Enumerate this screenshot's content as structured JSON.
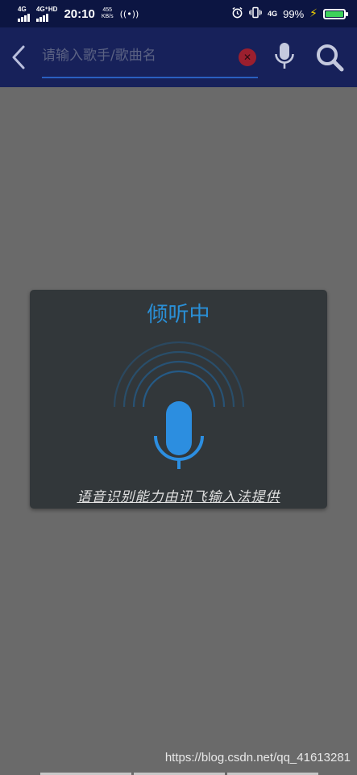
{
  "status_bar": {
    "sim1_label": "4G",
    "sim2_label": "4G⁺HD",
    "time": "20:10",
    "speed_value": "455",
    "speed_unit": "KB/s",
    "network_label": "4G",
    "battery_percent": "99%",
    "battery_level": 0.99,
    "battery_color": "#3ed35a",
    "icons": [
      "signal-icon",
      "hotspot-icon",
      "alarm-icon",
      "vibrate-icon",
      "charging-icon",
      "battery-icon"
    ]
  },
  "search_bar": {
    "placeholder": "请输入歌手/歌曲名",
    "value": "",
    "back_icon": "chevron-left-icon",
    "clear_icon": "clear-icon",
    "mic_icon": "microphone-icon",
    "search_icon": "search-icon",
    "background_color": "#17215a",
    "accent_color": "#2a5fc0"
  },
  "dialog": {
    "title": "倾听中",
    "caption": "语音识别能力由讯飞输入法提供",
    "mic_icon": "microphone-icon",
    "accent_color": "#2a8fd6"
  },
  "watermark": "https://blog.csdn.net/qq_41613281"
}
